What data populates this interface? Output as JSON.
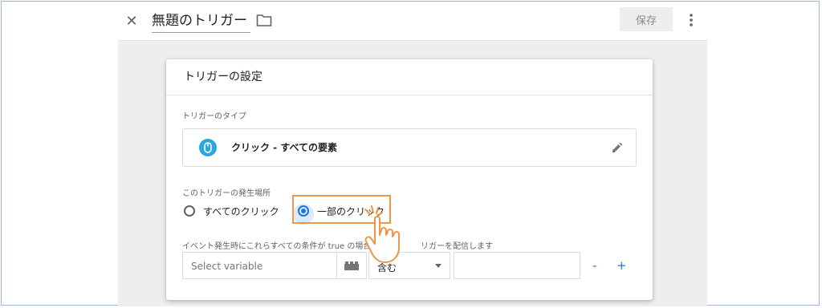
{
  "header": {
    "close_icon": "close-icon",
    "title": "無題のトリガー",
    "folder_icon": "folder-icon",
    "save_label": "保存",
    "more_icon": "more-vert-icon"
  },
  "card": {
    "title": "トリガーの設定",
    "type_section_label": "トリガーのタイプ",
    "trigger_type": {
      "icon": "mouse-icon",
      "name": "クリック - すべての要素",
      "edit_icon": "pencil-icon"
    },
    "fire_on_label": "このトリガーの発生場所",
    "fire_on_options": [
      {
        "label": "すべてのクリック",
        "selected": false
      },
      {
        "label": "一部のクリック",
        "selected": true
      }
    ],
    "conditions_label": "イベント発生時にこれらすべての条件が true の場合",
    "conditions_label_tail": "リガーを配信します",
    "condition": {
      "variable_placeholder": "Select variable",
      "operator": "含む",
      "value": ""
    },
    "remove_label": "-",
    "add_label": "+"
  },
  "colors": {
    "accent": "#1a73e8",
    "highlight": "#f0954a",
    "trigger_icon": "#29a8e0"
  }
}
